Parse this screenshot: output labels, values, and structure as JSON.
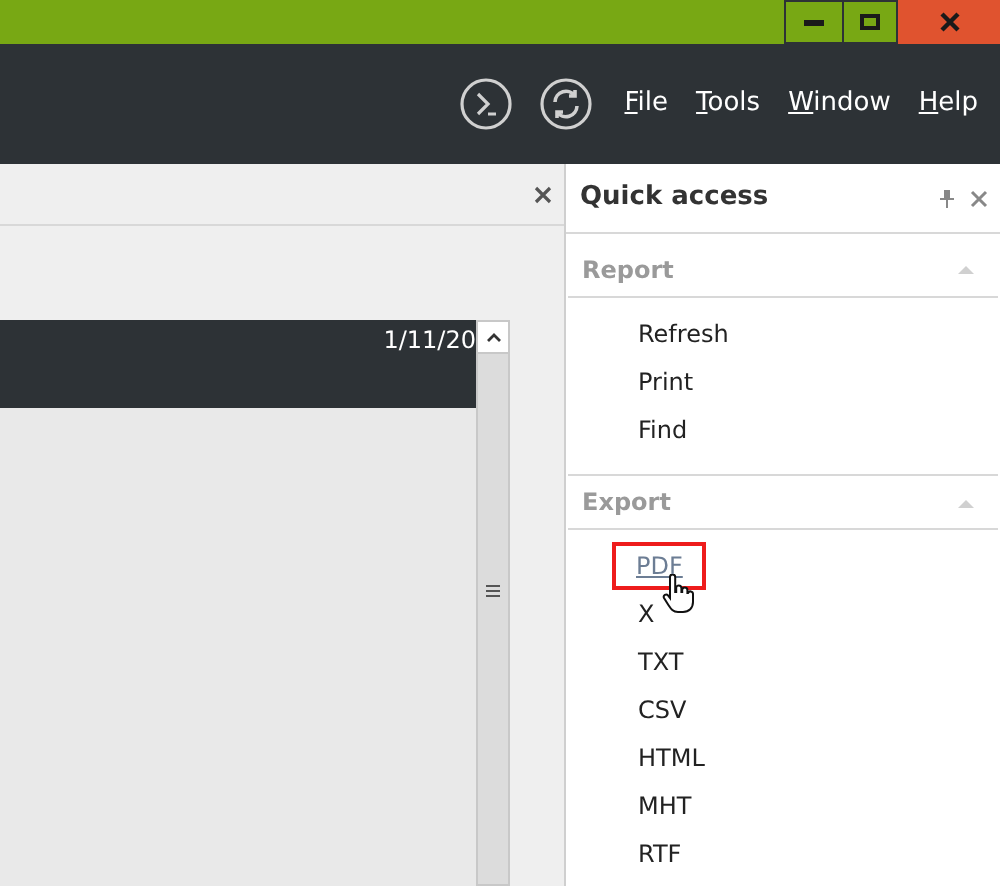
{
  "menu": [
    {
      "label": "File"
    },
    {
      "label": "Tools"
    },
    {
      "label": "Window"
    },
    {
      "label": "Help"
    }
  ],
  "report_header": {
    "date": "1/11/20"
  },
  "quick_access": {
    "title": "Quick access",
    "sections": [
      {
        "title": "Report",
        "expanded": true,
        "items": [
          {
            "label": "Refresh",
            "selected": false
          },
          {
            "label": "Print",
            "selected": false
          },
          {
            "label": "Find",
            "selected": false
          }
        ]
      },
      {
        "title": "Export",
        "expanded": true,
        "items": [
          {
            "label": "PDF",
            "selected": true
          },
          {
            "label": "X",
            "selected": false
          },
          {
            "label": "TXT",
            "selected": false
          },
          {
            "label": "CSV",
            "selected": false
          },
          {
            "label": "HTML",
            "selected": false
          },
          {
            "label": "MHT",
            "selected": false
          },
          {
            "label": "RTF",
            "selected": false
          }
        ]
      }
    ]
  }
}
